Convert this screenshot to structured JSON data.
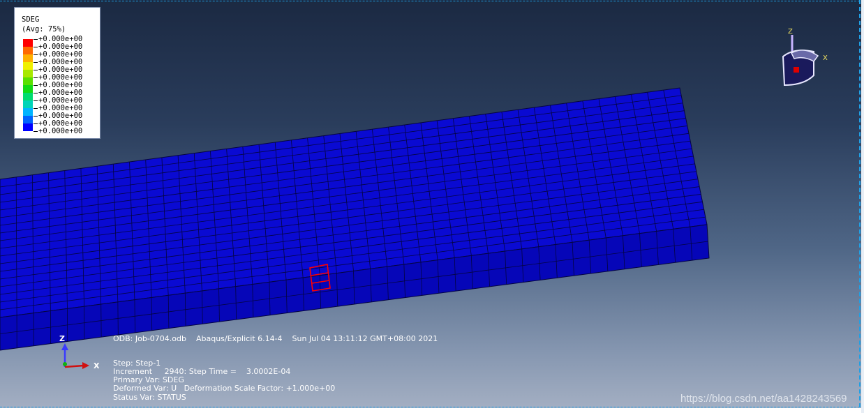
{
  "legend": {
    "title": "SDEG",
    "subtitle": "(Avg: 75%)",
    "labels": [
      "+0.000e+00",
      "+0.000e+00",
      "+0.000e+00",
      "+0.000e+00",
      "+0.000e+00",
      "+0.000e+00",
      "+0.000e+00",
      "+0.000e+00",
      "+0.000e+00",
      "+0.000e+00",
      "+0.000e+00",
      "+0.000e+00",
      "+0.000e+00"
    ],
    "colors": [
      "#ff0000",
      "#ff6a00",
      "#ffb000",
      "#f0f000",
      "#a8e800",
      "#5ae000",
      "#12dc14",
      "#00dc6e",
      "#00d4b8",
      "#00b4ff",
      "#0064ff",
      "#0000ff"
    ]
  },
  "model": {
    "element_color": "#0a0ad2",
    "edge_color": "#050540",
    "highlight_color": "#ff0000"
  },
  "info": {
    "odb_line": "ODB: Job-0704.odb    Abaqus/Explicit 6.14-4    Sun Jul 04 13:11:12 GMT+08:00 2021",
    "step": "Step: Step-1",
    "increment": "Increment     2940: Step Time =    3.0002E-04",
    "primary_var": "Primary Var: SDEG",
    "deformed_var": "Deformed Var: U   Deformation Scale Factor: +1.000e+00",
    "status_var": "Status Var: STATUS"
  },
  "triad": {
    "z_label": "Z",
    "x_label": "X"
  },
  "view_cube": {
    "z_label": "Z",
    "x_label": "X"
  },
  "watermark": "https://blog.csdn.net/aa1428243569"
}
